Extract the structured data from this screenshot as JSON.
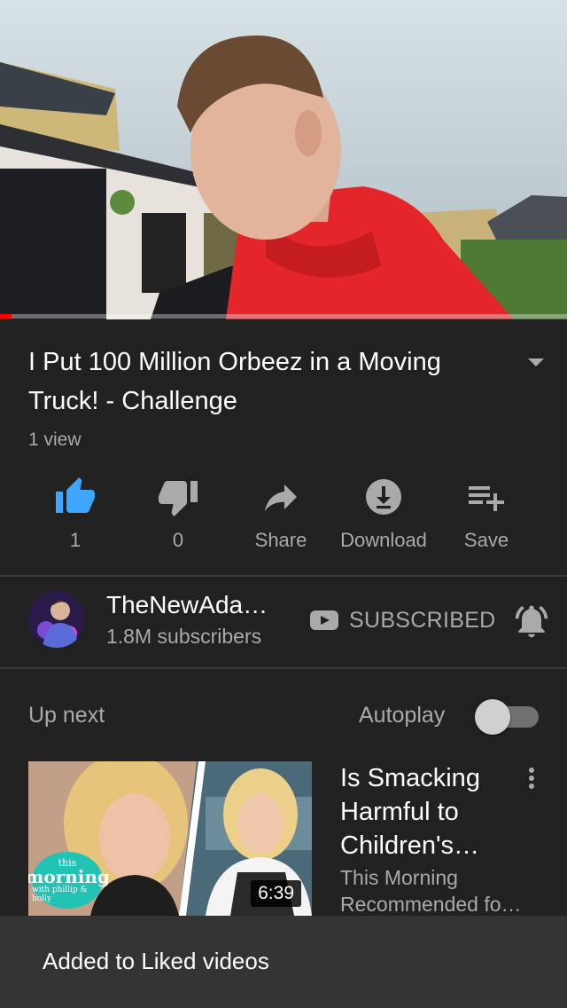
{
  "player": {
    "progress_percent": 2
  },
  "video": {
    "title": "I Put 100 Million Orbeez in a Moving Truck! - Challenge",
    "views": "1 view"
  },
  "actions": {
    "like_count": "1",
    "dislike_count": "0",
    "share_label": "Share",
    "download_label": "Download",
    "save_label": "Save"
  },
  "channel": {
    "name": "TheNewAda…",
    "subscribers": "1.8M subscribers",
    "subscribe_state": "SUBSCRIBED"
  },
  "up_next": {
    "label": "Up next",
    "autoplay_label": "Autoplay",
    "autoplay_on": false
  },
  "recommended": {
    "title_line1": "Is Smacking",
    "title_line2": "Harmful to",
    "title_line3": "Children's…",
    "channel": "This Morning",
    "meta": "Recommended fo…",
    "duration": "6:39",
    "logo_line1": "this",
    "logo_line2": "morning",
    "logo_line3": "with phillip & holly"
  },
  "snackbar": {
    "message": "Added to Liked videos"
  },
  "colors": {
    "background": "#212121",
    "liked_blue": "#3ea6ff",
    "progress_red": "#ff0000",
    "secondary_text": "#aaaaaa",
    "snackbar_bg": "#333333"
  },
  "icons": [
    "thumbs-up-icon",
    "thumbs-down-icon",
    "share-icon",
    "download-icon",
    "save-playlist-icon",
    "youtube-icon",
    "bell-icon",
    "more-vert-icon",
    "chevron-down-icon"
  ]
}
